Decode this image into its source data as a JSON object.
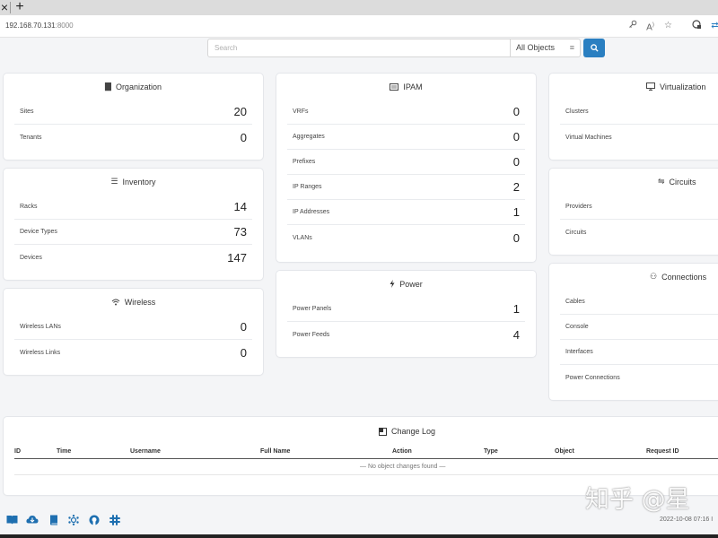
{
  "browser": {
    "url_host": "192.168.70.131",
    "url_port": ":8000"
  },
  "search": {
    "placeholder": "Search",
    "scope": "All Objects"
  },
  "cards": {
    "organization": {
      "title": "Organization",
      "rows": [
        {
          "label": "Sites",
          "value": "20"
        },
        {
          "label": "Tenants",
          "value": "0"
        }
      ]
    },
    "inventory": {
      "title": "Inventory",
      "rows": [
        {
          "label": "Racks",
          "value": "14"
        },
        {
          "label": "Device Types",
          "value": "73"
        },
        {
          "label": "Devices",
          "value": "147"
        }
      ]
    },
    "wireless": {
      "title": "Wireless",
      "rows": [
        {
          "label": "Wireless LANs",
          "value": "0"
        },
        {
          "label": "Wireless Links",
          "value": "0"
        }
      ]
    },
    "ipam": {
      "title": "IPAM",
      "rows": [
        {
          "label": "VRFs",
          "value": "0"
        },
        {
          "label": "Aggregates",
          "value": "0"
        },
        {
          "label": "Prefixes",
          "value": "0"
        },
        {
          "label": "IP Ranges",
          "value": "2"
        },
        {
          "label": "IP Addresses",
          "value": "1"
        },
        {
          "label": "VLANs",
          "value": "0"
        }
      ]
    },
    "power": {
      "title": "Power",
      "rows": [
        {
          "label": "Power Panels",
          "value": "1"
        },
        {
          "label": "Power Feeds",
          "value": "4"
        }
      ]
    },
    "virtualization": {
      "title": "Virtualization",
      "rows": [
        {
          "label": "Clusters",
          "value": ""
        },
        {
          "label": "Virtual Machines",
          "value": ""
        }
      ]
    },
    "circuits": {
      "title": "Circuits",
      "rows": [
        {
          "label": "Providers",
          "value": ""
        },
        {
          "label": "Circuits",
          "value": ""
        }
      ]
    },
    "connections": {
      "title": "Connections",
      "rows": [
        {
          "label": "Cables",
          "value": ""
        },
        {
          "label": "Console",
          "value": ""
        },
        {
          "label": "Interfaces",
          "value": ""
        },
        {
          "label": "Power Connections",
          "value": ""
        }
      ]
    }
  },
  "changelog": {
    "title": "Change Log",
    "columns": [
      "ID",
      "Time",
      "Username",
      "Full Name",
      "Action",
      "Type",
      "Object",
      "Request ID"
    ],
    "empty_text": "— No object changes found —"
  },
  "footer": {
    "timestamp": "2022-10-08 07:16 I",
    "watermark": "知乎 @星"
  }
}
